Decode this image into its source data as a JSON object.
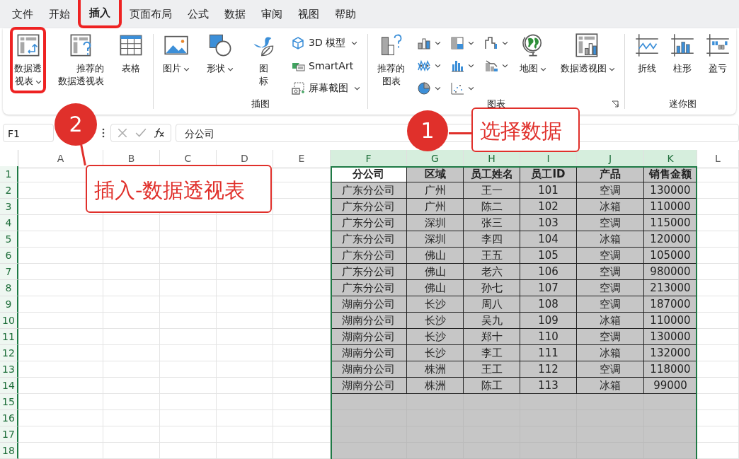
{
  "tabs": [
    {
      "label": "文件",
      "selected": false,
      "highlighted": false
    },
    {
      "label": "开始",
      "selected": false,
      "highlighted": false
    },
    {
      "label": "插入",
      "selected": true,
      "highlighted": true
    },
    {
      "label": "页面布局",
      "selected": false,
      "highlighted": false
    },
    {
      "label": "公式",
      "selected": false,
      "highlighted": false
    },
    {
      "label": "数据",
      "selected": false,
      "highlighted": false
    },
    {
      "label": "审阅",
      "selected": false,
      "highlighted": false
    },
    {
      "label": "视图",
      "selected": false,
      "highlighted": false
    },
    {
      "label": "帮助",
      "selected": false,
      "highlighted": false
    }
  ],
  "ribbon": {
    "groups": [
      {
        "items": [
          {
            "kind": "large",
            "label": "数据透视表",
            "dropdown": true,
            "highlighted": true
          },
          {
            "kind": "large",
            "label": "推荐的数据透视表",
            "dropdown": false,
            "highlighted": false
          },
          {
            "kind": "large",
            "label": "表格",
            "dropdown": false,
            "highlighted": false
          }
        ]
      },
      {
        "label": "插图",
        "items": [
          {
            "kind": "large",
            "label": "图片",
            "dropdown": true,
            "highlighted": false
          },
          {
            "kind": "large",
            "label": "形状",
            "dropdown": true,
            "highlighted": false
          },
          {
            "kind": "large",
            "label": "图标",
            "dropdown": false,
            "highlighted": false
          },
          {
            "kind": "stack",
            "items": [
              {
                "kind": "small",
                "label": "3D 模型",
                "dropdown": true
              },
              {
                "kind": "small",
                "label": "SmartArt",
                "dropdown": false
              },
              {
                "kind": "small",
                "label": "屏幕截图",
                "dropdown": true
              }
            ]
          }
        ]
      },
      {
        "label": "图表",
        "launcher": true,
        "items": [
          {
            "kind": "large",
            "label": "推荐的图表",
            "dropdown": false,
            "highlighted": false
          },
          {
            "kind": "stack",
            "items": [
              {
                "kind": "icon",
                "dropdown": true
              },
              {
                "kind": "icon",
                "dropdown": true
              },
              {
                "kind": "icon",
                "dropdown": true
              }
            ]
          },
          {
            "kind": "stack",
            "items": [
              {
                "kind": "icon",
                "dropdown": true
              },
              {
                "kind": "icon",
                "dropdown": true
              },
              {
                "kind": "icon",
                "dropdown": true
              }
            ]
          },
          {
            "kind": "stack",
            "items": [
              {
                "kind": "icon",
                "dropdown": true
              },
              {
                "kind": "icon",
                "dropdown": true
              }
            ]
          },
          {
            "kind": "large",
            "label": "地图",
            "dropdown": true,
            "highlighted": false
          },
          {
            "kind": "large",
            "label": "数据透视图",
            "dropdown": true,
            "highlighted": false
          }
        ]
      },
      {
        "label": "迷你图",
        "items": [
          {
            "kind": "large",
            "label": "折线",
            "dropdown": false,
            "highlighted": false
          },
          {
            "kind": "large",
            "label": "柱形",
            "dropdown": false,
            "highlighted": false
          },
          {
            "kind": "large",
            "label": "盈亏",
            "dropdown": false,
            "highlighted": false
          }
        ]
      }
    ]
  },
  "formula_bar": {
    "name_box": "F1",
    "formula": "分公司"
  },
  "sheet": {
    "columns": [
      {
        "label": "A",
        "selected": false
      },
      {
        "label": "B",
        "selected": false
      },
      {
        "label": "C",
        "selected": false
      },
      {
        "label": "D",
        "selected": false
      },
      {
        "label": "E",
        "selected": false
      },
      {
        "label": "F",
        "selected": true
      },
      {
        "label": "G",
        "selected": true
      },
      {
        "label": "H",
        "selected": true
      },
      {
        "label": "I",
        "selected": true
      },
      {
        "label": "J",
        "selected": true
      },
      {
        "label": "K",
        "selected": true
      },
      {
        "label": "L",
        "selected": false
      }
    ],
    "rows": [
      {
        "number": "1",
        "cells": [
          "",
          "",
          "",
          "",
          "",
          "分公司",
          "区域",
          "员工姓名",
          "员工ID",
          "产品",
          "销售金额"
        ]
      },
      {
        "number": "2",
        "cells": [
          "",
          "",
          "",
          "",
          "",
          "广东分公司",
          "广州",
          "王一",
          "101",
          "空调",
          "130000"
        ]
      },
      {
        "number": "3",
        "cells": [
          "",
          "",
          "",
          "",
          "",
          "广东分公司",
          "广州",
          "陈二",
          "102",
          "冰箱",
          "110000"
        ]
      },
      {
        "number": "4",
        "cells": [
          "",
          "",
          "",
          "",
          "",
          "广东分公司",
          "深圳",
          "张三",
          "103",
          "空调",
          "115000"
        ]
      },
      {
        "number": "5",
        "cells": [
          "",
          "",
          "",
          "",
          "",
          "广东分公司",
          "深圳",
          "李四",
          "104",
          "冰箱",
          "120000"
        ]
      },
      {
        "number": "6",
        "cells": [
          "",
          "",
          "",
          "",
          "",
          "广东分公司",
          "佛山",
          "王五",
          "105",
          "空调",
          "105000"
        ]
      },
      {
        "number": "7",
        "cells": [
          "",
          "",
          "",
          "",
          "",
          "广东分公司",
          "佛山",
          "老六",
          "106",
          "空调",
          "980000"
        ]
      },
      {
        "number": "8",
        "cells": [
          "",
          "",
          "",
          "",
          "",
          "广东分公司",
          "佛山",
          "孙七",
          "107",
          "空调",
          "213000"
        ]
      },
      {
        "number": "9",
        "cells": [
          "",
          "",
          "",
          "",
          "",
          "湖南分公司",
          "长沙",
          "周八",
          "108",
          "空调",
          "187000"
        ]
      },
      {
        "number": "10",
        "cells": [
          "",
          "",
          "",
          "",
          "",
          "湖南分公司",
          "长沙",
          "吴九",
          "109",
          "冰箱",
          "110000"
        ]
      },
      {
        "number": "11",
        "cells": [
          "",
          "",
          "",
          "",
          "",
          "湖南分公司",
          "长沙",
          "郑十",
          "110",
          "空调",
          "130000"
        ]
      },
      {
        "number": "12",
        "cells": [
          "",
          "",
          "",
          "",
          "",
          "湖南分公司",
          "长沙",
          "李工",
          "111",
          "冰箱",
          "132000"
        ]
      },
      {
        "number": "13",
        "cells": [
          "",
          "",
          "",
          "",
          "",
          "湖南分公司",
          "株洲",
          "王工",
          "112",
          "空调",
          "118000"
        ]
      },
      {
        "number": "14",
        "cells": [
          "",
          "",
          "",
          "",
          "",
          "湖南分公司",
          "株洲",
          "陈工",
          "113",
          "冰箱",
          "99000"
        ]
      },
      {
        "number": "15",
        "cells": []
      },
      {
        "number": "16",
        "cells": []
      },
      {
        "number": "17",
        "cells": []
      },
      {
        "number": "18",
        "cells": []
      }
    ]
  },
  "annotations": [
    {
      "number": "2",
      "text": "插入-数据透视表"
    },
    {
      "number": "1",
      "text": "选择数据"
    }
  ]
}
